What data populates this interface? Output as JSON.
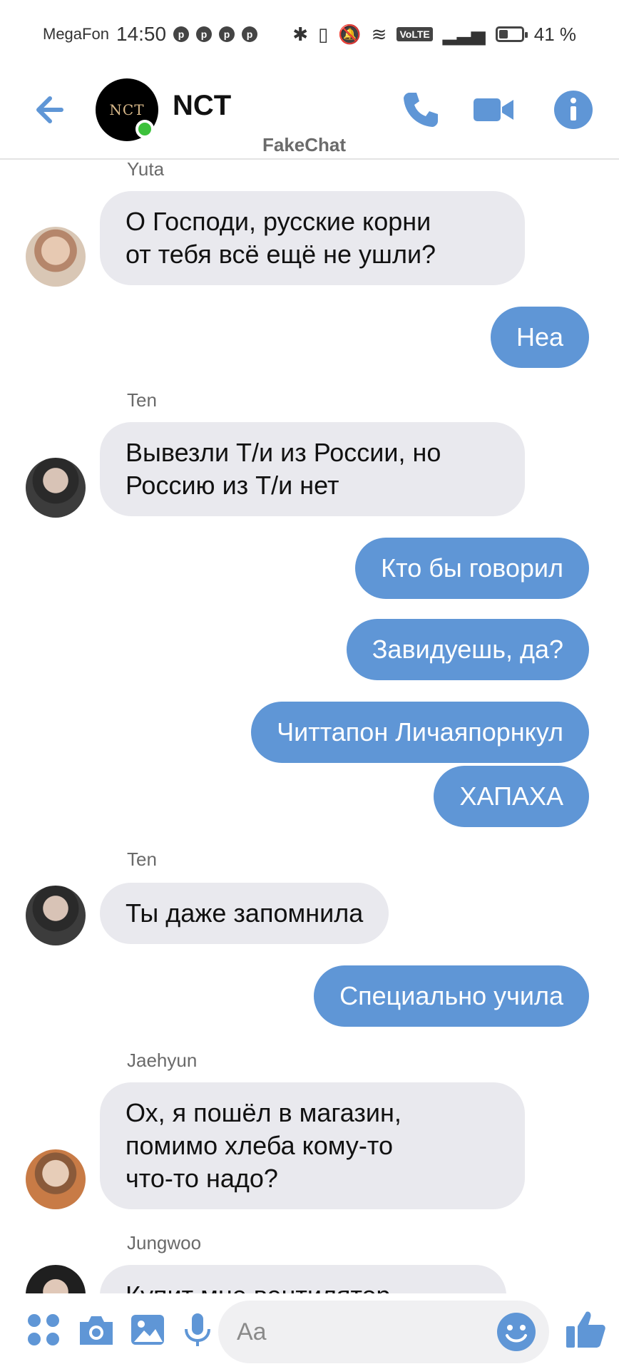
{
  "status_bar": {
    "carrier": "MegaFon",
    "time": "14:50",
    "volte": "VoLTE",
    "battery": "41 %",
    "battery_level": 0.41
  },
  "header": {
    "title": "NCT",
    "avatar_logo": "NCT",
    "watermark": "FakeChat"
  },
  "messages": [
    {
      "sender": "Yuta",
      "side": "in",
      "avatar": "yuta",
      "text": "О Господи, русские корни\nот тебя всё ещё не ушли?"
    },
    {
      "side": "out",
      "text": "Неа"
    },
    {
      "sender": "Ten",
      "side": "in",
      "avatar": "ten",
      "text": "Вывезли Т/и из России, но\nРоссию из Т/и нет"
    },
    {
      "side": "out",
      "text": "Кто бы говорил"
    },
    {
      "side": "out",
      "text": "Завидуешь, да?"
    },
    {
      "side": "out",
      "text": "Читтапон Личаяпорнкул"
    },
    {
      "side": "out",
      "text": "ХАПАХА"
    },
    {
      "sender": "Ten",
      "side": "in",
      "avatar": "ten",
      "text": "Ты даже запомнила"
    },
    {
      "side": "out",
      "text": "Специально учила"
    },
    {
      "sender": "Jaehyun",
      "side": "in",
      "avatar": "jaehyun",
      "text": "Ох, я пошёл в магазин,\nпомимо хлеба кому-то\nчто-то надо?"
    },
    {
      "sender": "Jungwoo",
      "side": "in",
      "avatar": "jungwoo",
      "text": "Купит мне вентилятор"
    }
  ],
  "composer": {
    "placeholder": "Aa"
  },
  "colors": {
    "accent": "#5f96d6",
    "incoming_bubble": "#e9e9ee",
    "online": "#3cc13b"
  },
  "icons": [
    "back-arrow-icon",
    "phone-icon",
    "video-icon",
    "info-icon",
    "apps-icon",
    "camera-icon",
    "image-icon",
    "mic-icon",
    "emoji-icon",
    "like-icon"
  ]
}
